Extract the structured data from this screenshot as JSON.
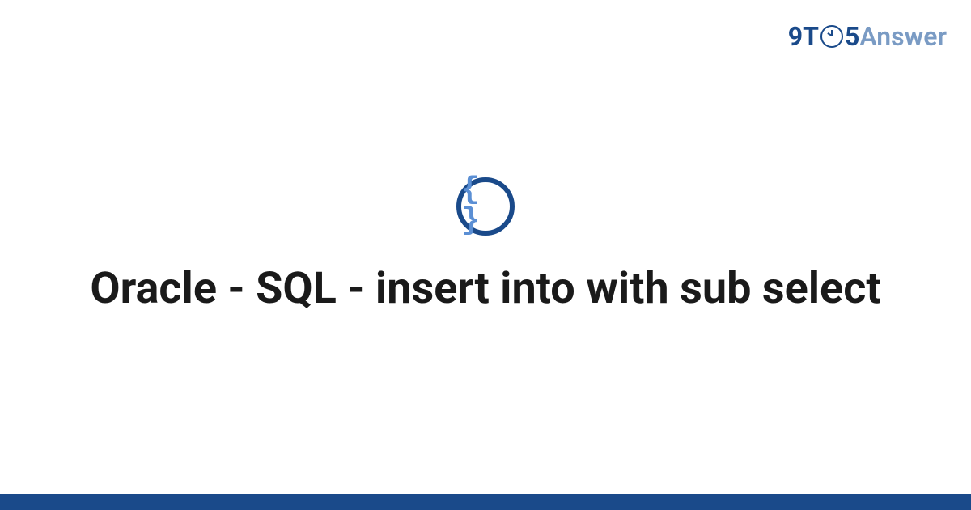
{
  "logo": {
    "part1": "9T",
    "part2": "5",
    "part3": "Answer"
  },
  "badge": {
    "glyph": "{ }"
  },
  "title": "Oracle - SQL - insert into with sub select",
  "colors": {
    "primary": "#1a4a8a",
    "secondary": "#5b8fd4",
    "muted": "#7a9bc4"
  }
}
